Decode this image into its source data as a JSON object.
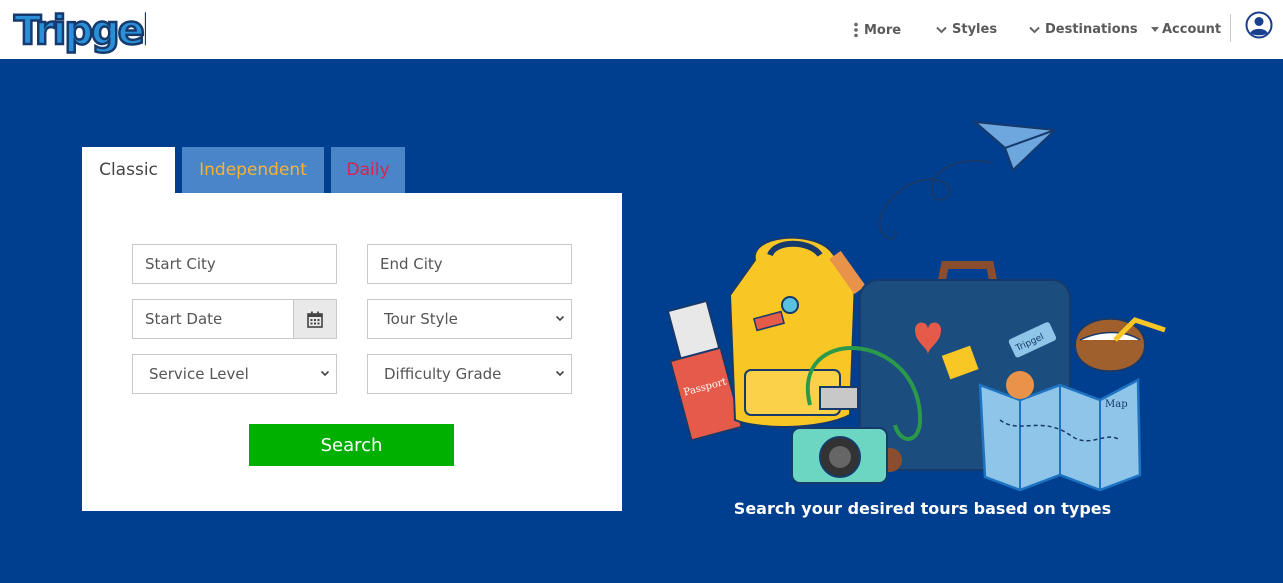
{
  "header": {
    "logo_text": "Tripgel",
    "nav": {
      "more": "More",
      "styles": "Styles",
      "destinations": "Destinations",
      "account": "Account"
    }
  },
  "tabs": {
    "classic": "Classic",
    "independent": "Independent",
    "daily": "Daily"
  },
  "form": {
    "start_city_placeholder": "Start City",
    "end_city_placeholder": "End City",
    "start_date_placeholder": "Start Date",
    "tour_style": "Tour Style",
    "service_level": "Service Level",
    "difficulty_grade": "Difficulty Grade",
    "search_label": "Search"
  },
  "hero": {
    "tagline": "Search your desired tours based on types",
    "illustration_labels": {
      "passport": "Passport",
      "luggage_tag": "Tripgel",
      "map": "Map"
    }
  },
  "colors": {
    "hero_bg": "#003f8f",
    "tab_inactive_bg": "#4a85c9",
    "independent_text": "#f4b430",
    "daily_text": "#e0204a",
    "search_button": "#00b000"
  },
  "icons": {
    "more": "more-vertical-icon",
    "dropdown": "chevron-down-icon",
    "account": "user-circle-icon",
    "calendar": "calendar-icon"
  }
}
